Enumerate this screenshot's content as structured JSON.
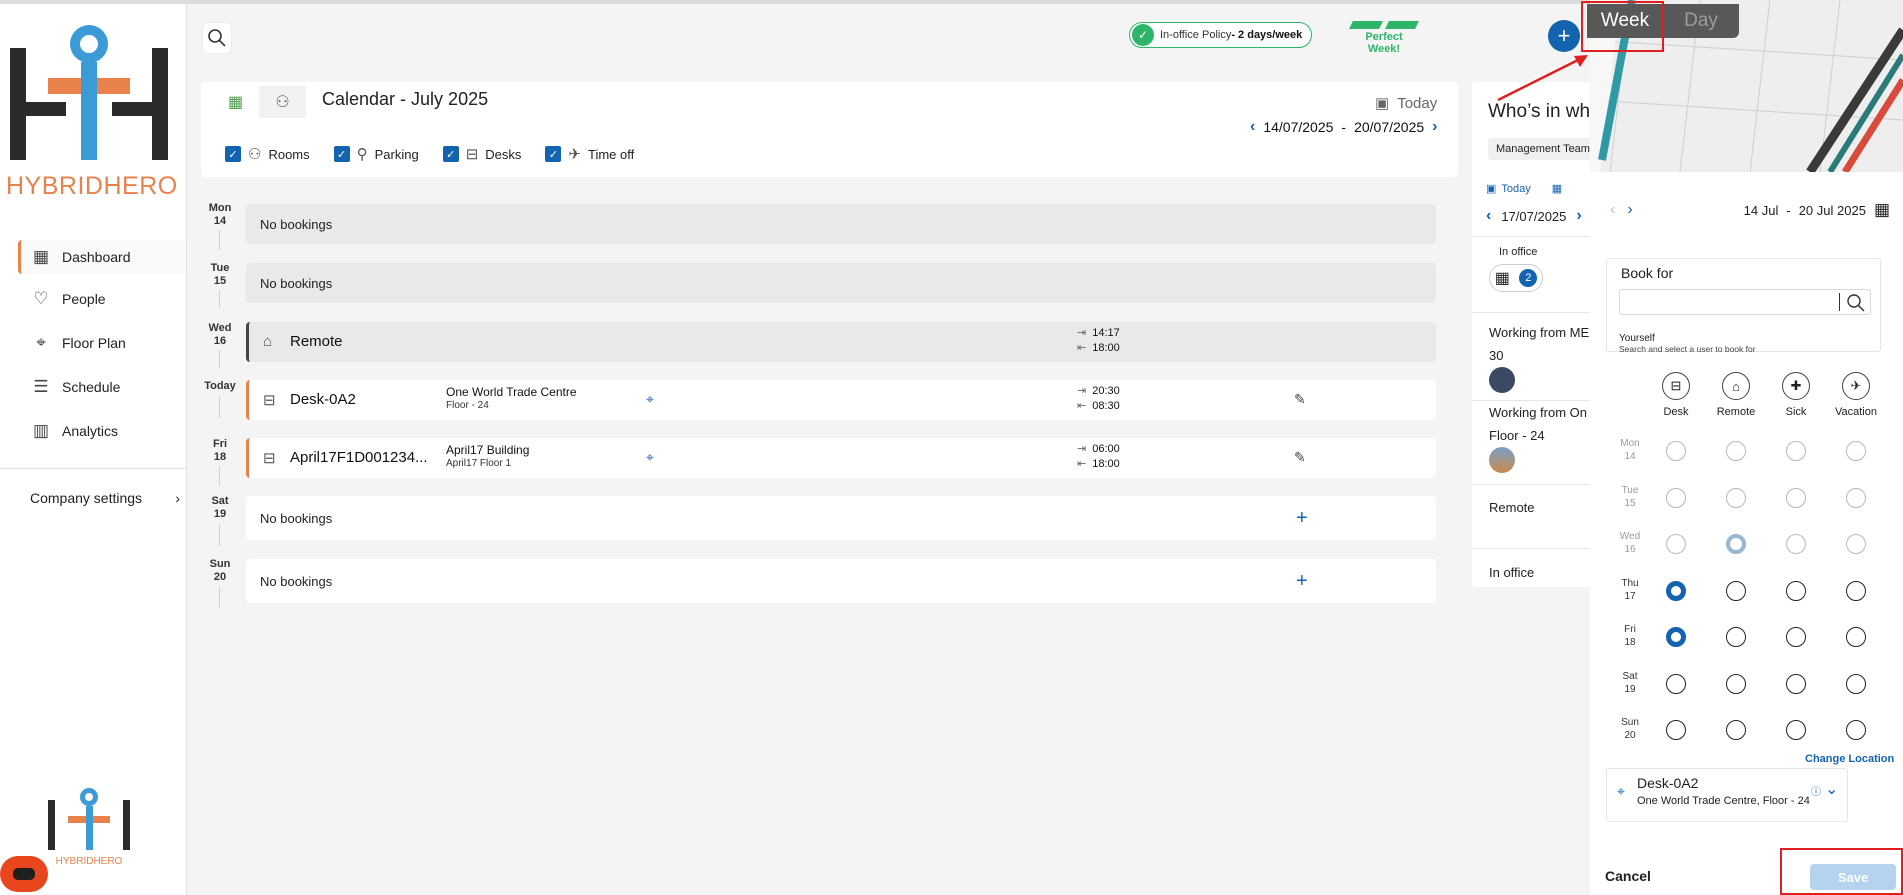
{
  "brand": {
    "word1": "HYBRID",
    "word2": "HERO",
    "mini": "HYBRIDHERO"
  },
  "sidebar": {
    "items": [
      {
        "label": "Dashboard",
        "icon": "dashboard-icon",
        "active": true
      },
      {
        "label": "People",
        "icon": "heartbeat-icon"
      },
      {
        "label": "Floor Plan",
        "icon": "location-pin-icon"
      },
      {
        "label": "Schedule",
        "icon": "checklist-icon"
      },
      {
        "label": "Analytics",
        "icon": "bar-chart-icon"
      }
    ],
    "company_settings": "Company settings"
  },
  "header": {
    "policy_prefix": "In-office Policy",
    "policy_value": "- 2 days/week",
    "perfect_week": "Perfect Week!",
    "add_label": "+"
  },
  "calendar": {
    "title": "Calendar - July 2025",
    "today": "Today",
    "range_start": "14/07/2025",
    "range_sep": "-",
    "range_end": "20/07/2025",
    "filters": [
      "Rooms",
      "Parking",
      "Desks",
      "Time off"
    ],
    "days": [
      {
        "dow": "Mon",
        "num": "14",
        "empty": "No bookings"
      },
      {
        "dow": "Tue",
        "num": "15",
        "empty": "No bookings"
      },
      {
        "dow": "Wed",
        "num": "16",
        "name": "Remote",
        "in": "14:17",
        "out": "18:00"
      },
      {
        "dow": "Today",
        "num": "",
        "name": "Desk-0A2",
        "building": "One World Trade Centre",
        "floor": "Floor - 24",
        "in": "20:30",
        "out": "08:30"
      },
      {
        "dow": "Fri",
        "num": "18",
        "name": "April17F1D001234...",
        "building": "April17 Building",
        "floor": "April17 Floor 1",
        "in": "06:00",
        "out": "18:00"
      },
      {
        "dow": "Sat",
        "num": "19",
        "empty": "No bookings"
      },
      {
        "dow": "Sun",
        "num": "20",
        "empty": "No bookings"
      }
    ]
  },
  "who": {
    "title": "Who’s in wh",
    "team": "Management Team",
    "today": "Today",
    "date": "17/07/2025",
    "in_office_label": "In office",
    "in_office_count": "2",
    "working_from_1": "Working from ME",
    "count_1": "30",
    "working_from_2": "Working from On",
    "floor_2": "Floor - 24",
    "remote": "Remote",
    "in_office": "In office"
  },
  "panel": {
    "toggle_week": "Week",
    "toggle_day": "Day",
    "range_start": "14 Jul",
    "range_sep": "-",
    "range_end": "20 Jul 2025",
    "book_for": "Book for",
    "yourself": "Yourself",
    "yourself_hint": "Search and select a user to book for",
    "options": [
      "Desk",
      "Remote",
      "Sick",
      "Vacation"
    ],
    "days": [
      {
        "dow": "Mon",
        "num": "14"
      },
      {
        "dow": "Tue",
        "num": "15"
      },
      {
        "dow": "Wed",
        "num": "16"
      },
      {
        "dow": "Thu",
        "num": "17"
      },
      {
        "dow": "Fri",
        "num": "18"
      },
      {
        "dow": "Sat",
        "num": "19"
      },
      {
        "dow": "Sun",
        "num": "20"
      }
    ],
    "change_location": "Change Location",
    "desk_name": "Desk-0A2",
    "desk_location": "One World Trade Centre, Floor - 24",
    "cancel": "Cancel",
    "save": "Save"
  },
  "colors": {
    "accent": "#1463b0",
    "brand_orange": "#e8824a",
    "success": "#2db56a",
    "highlight": "#e02020"
  }
}
